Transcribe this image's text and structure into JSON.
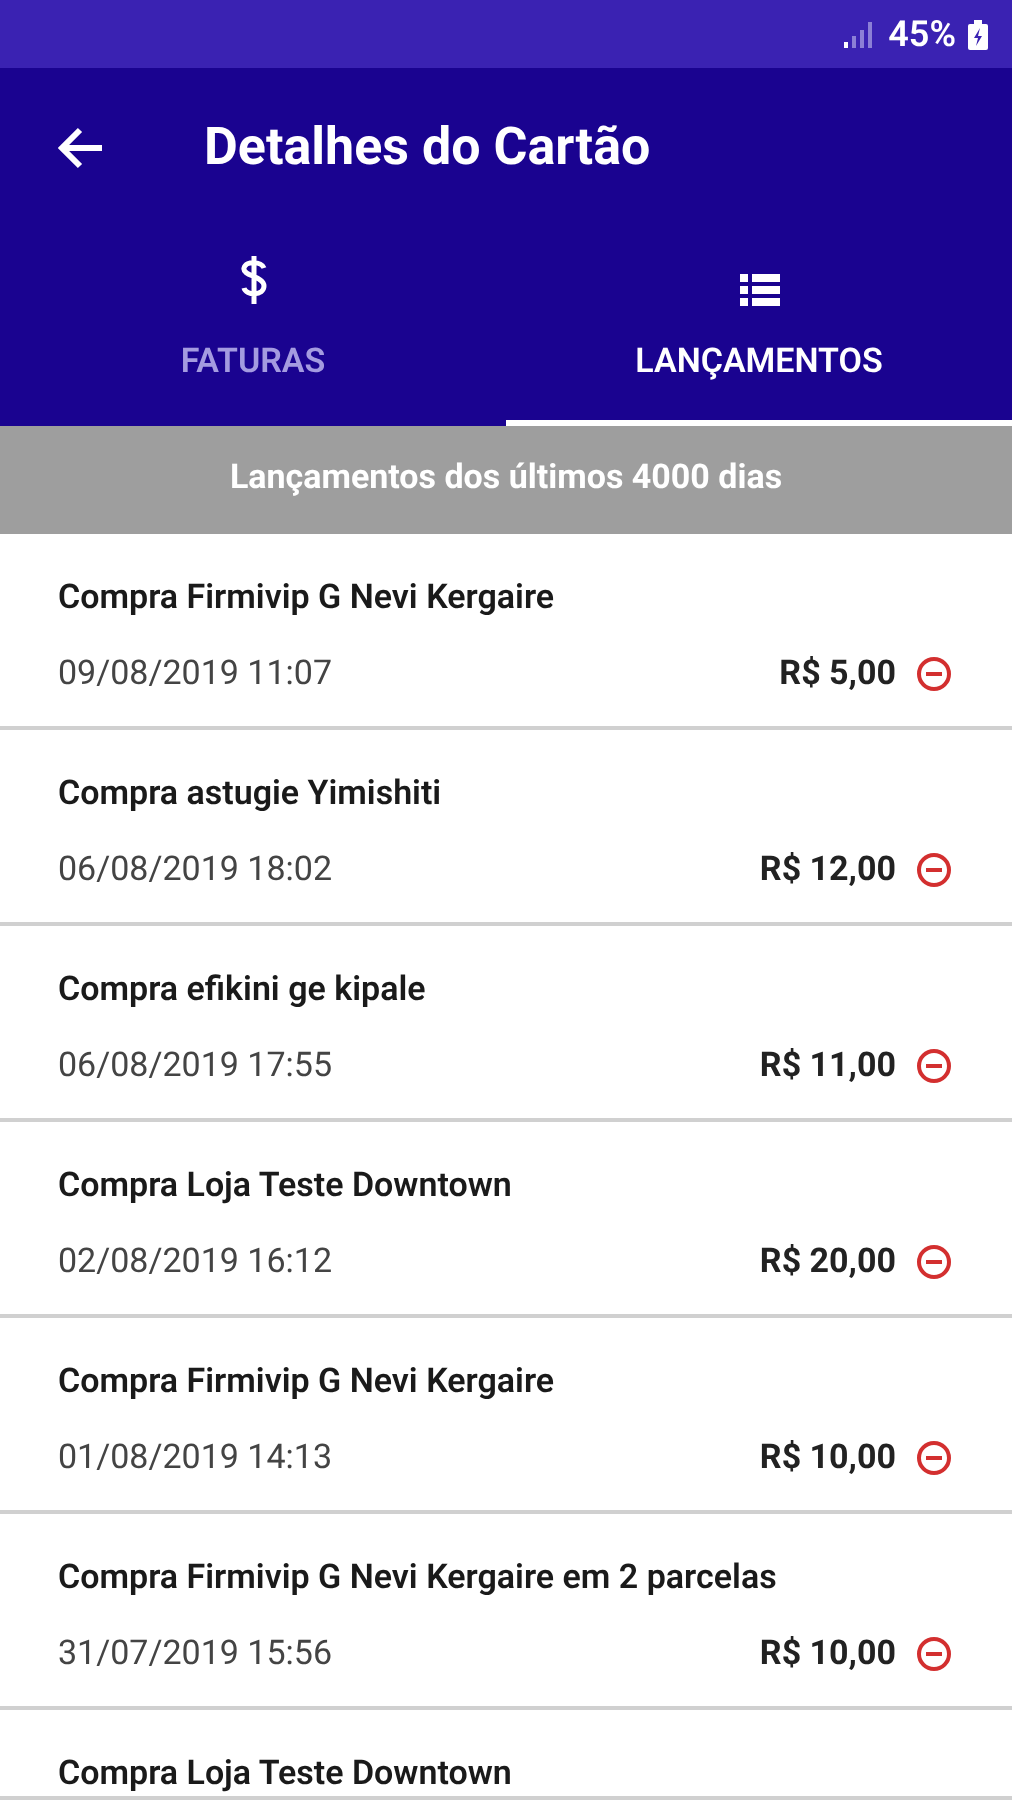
{
  "status_bar": {
    "battery": "45%"
  },
  "app_bar": {
    "title": "Detalhes do Cartão"
  },
  "tabs": [
    {
      "label": "FATURAS",
      "kind": "dollar",
      "selected": false
    },
    {
      "label": "LANÇAMENTOS",
      "kind": "list",
      "selected": true
    }
  ],
  "banner": "Lançamentos dos últimos 4000 dias",
  "transactions": [
    {
      "description": "Compra Firmivip G Nevi Kergaire",
      "date": "09/08/2019 11:07",
      "amount": "R$ 5,00"
    },
    {
      "description": "Compra astugie Yimishiti",
      "date": "06/08/2019 18:02",
      "amount": "R$ 12,00"
    },
    {
      "description": "Compra efikini ge kipale",
      "date": "06/08/2019 17:55",
      "amount": "R$ 11,00"
    },
    {
      "description": "Compra Loja Teste Downtown",
      "date": "02/08/2019 16:12",
      "amount": "R$ 20,00"
    },
    {
      "description": "Compra Firmivip G Nevi Kergaire",
      "date": "01/08/2019 14:13",
      "amount": "R$ 10,00"
    },
    {
      "description": "Compra Firmivip G Nevi Kergaire em 2 parcelas",
      "date": "31/07/2019 15:56",
      "amount": "R$ 10,00"
    },
    {
      "description": "Compra Loja Teste Downtown"
    }
  ]
}
